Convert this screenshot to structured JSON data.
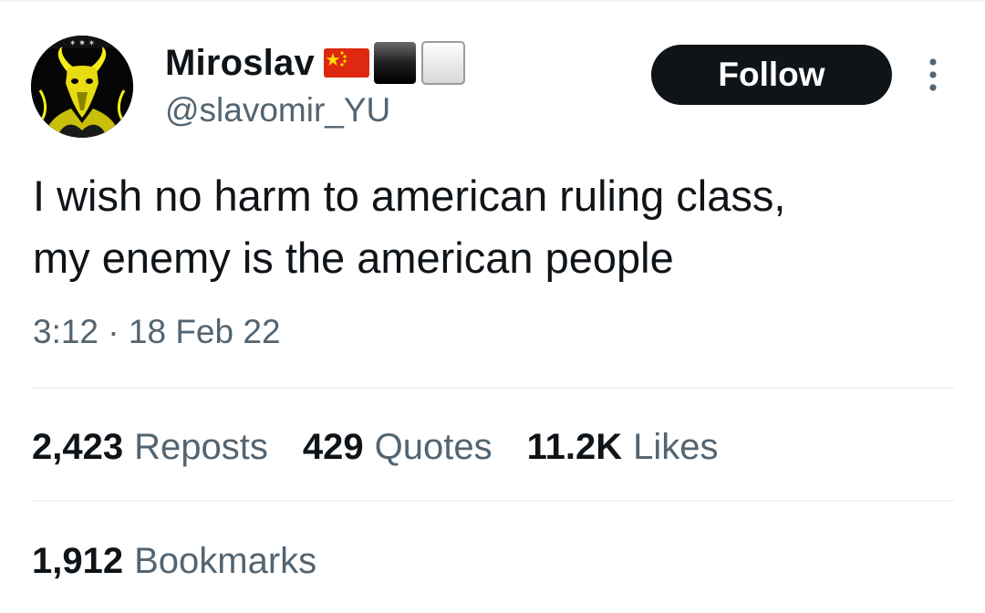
{
  "author": {
    "display_name": "Miroslav",
    "handle": "@slavomir_YU",
    "avatar_icon": "goat-skull-avatar",
    "name_emojis": [
      "china-flag-icon",
      "black-square-icon",
      "white-square-icon"
    ]
  },
  "follow_button": {
    "label": "Follow"
  },
  "more_menu": {
    "icon": "more-options-icon"
  },
  "tweet": {
    "lines": [
      "I wish no harm to american ruling class,",
      "my enemy is the american people"
    ],
    "timestamp": "3:12 · 18 Feb 22"
  },
  "stats": {
    "reposts": {
      "value": "2,423",
      "label": "Reposts"
    },
    "quotes": {
      "value": "429",
      "label": "Quotes"
    },
    "likes": {
      "value": "11.2K",
      "label": "Likes"
    },
    "bookmarks": {
      "value": "1,912",
      "label": "Bookmarks"
    }
  },
  "colors": {
    "text_primary": "#0f1419",
    "text_secondary": "#536471",
    "divider": "#eff3f4",
    "follow_bg": "#0f1419",
    "follow_text": "#ffffff",
    "avatar_accent": "#f5ec1a"
  }
}
